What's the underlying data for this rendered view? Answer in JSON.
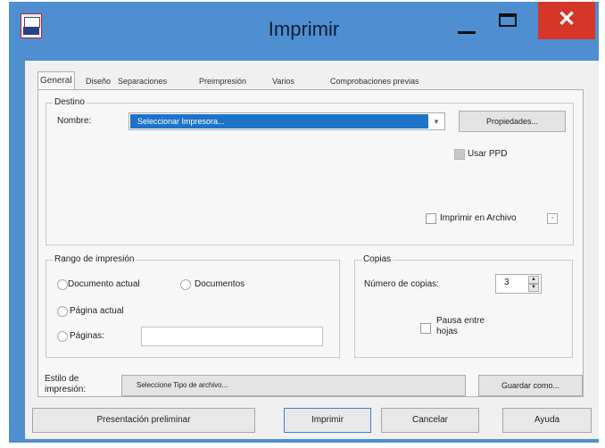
{
  "window": {
    "title": "Imprimir",
    "close_glyph": "✕"
  },
  "tabs": [
    {
      "label": "General",
      "active": true
    },
    {
      "label": "Diseño"
    },
    {
      "label": "Separaciones"
    },
    {
      "label": "Preimpresión"
    },
    {
      "label": "Varios"
    },
    {
      "label": "Comprobaciones previas"
    }
  ],
  "destino": {
    "legend": "Destino",
    "nombre_label": "Nombre:",
    "printer_value": "Seleccionar Impresora...",
    "properties_button": "Propiedades...",
    "usar_ppd_label": "Usar PPD",
    "print_to_file_label": "Imprimir en Archivo"
  },
  "rango": {
    "legend": "Rango de impresión",
    "options": {
      "documento_actual": "Documento actual",
      "documentos": "Documentos",
      "pagina_actual": "Página actual",
      "paginas": "Páginas:"
    }
  },
  "copias": {
    "legend": "Copias",
    "numero_label": "Número de copias:",
    "value": "3",
    "pausa_label_line1": "Pausa entre",
    "pausa_label_line2": "hojas"
  },
  "estilo": {
    "label_line1": "Estilo de",
    "label_line2": "impresión:",
    "select_value": "Seleccione Tipo de archivo...",
    "save_as_button": "Guardar como..."
  },
  "buttons": {
    "preview": "Presentación preliminar",
    "print": "Imprimir",
    "cancel": "Cancelar",
    "help": "Ayuda"
  },
  "icons": {
    "app": "printer-app-icon",
    "minimize": "minimize-icon",
    "maximize": "maximize-icon",
    "close": "close-icon"
  },
  "colors": {
    "title_bar": "#4f8ed1",
    "close": "#d4372a",
    "selection": "#1e73c8"
  }
}
